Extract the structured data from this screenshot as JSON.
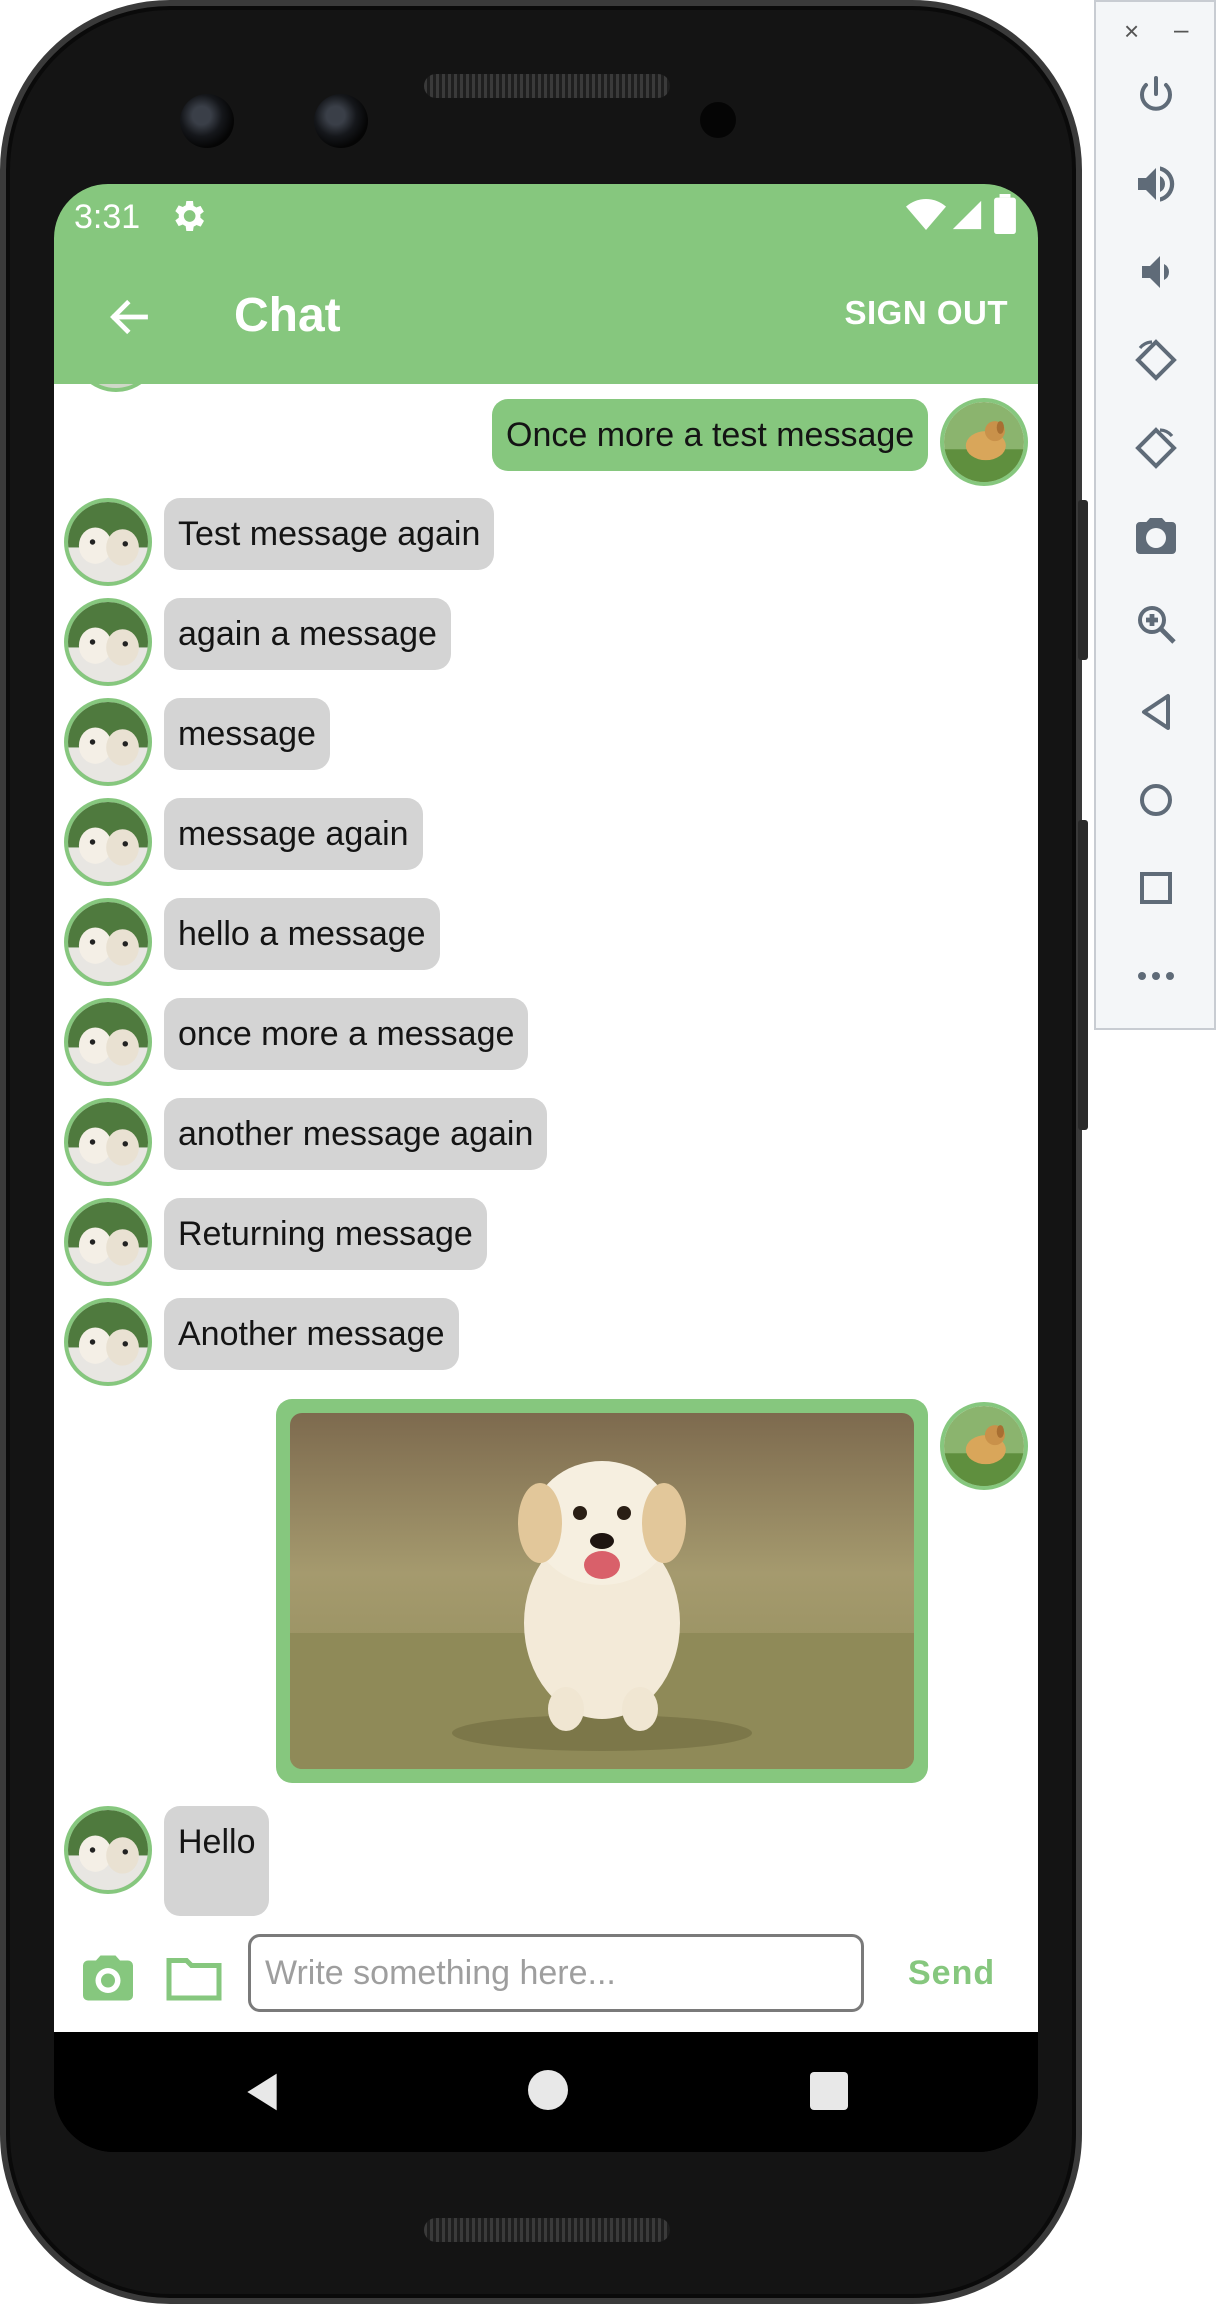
{
  "status_bar": {
    "time": "3:31"
  },
  "app_bar": {
    "title": "Chat",
    "sign_out_label": "SIGN OUT"
  },
  "messages": [
    {
      "direction": "outgoing",
      "text": "Once more a test message"
    },
    {
      "direction": "incoming",
      "text": "Test message again"
    },
    {
      "direction": "incoming",
      "text": "again a message"
    },
    {
      "direction": "incoming",
      "text": "message"
    },
    {
      "direction": "incoming",
      "text": "message again"
    },
    {
      "direction": "incoming",
      "text": "hello a message"
    },
    {
      "direction": "incoming",
      "text": "once more a message"
    },
    {
      "direction": "incoming",
      "text": "another message again"
    },
    {
      "direction": "incoming",
      "text": "Returning message"
    },
    {
      "direction": "incoming",
      "text": "Another message"
    },
    {
      "direction": "outgoing",
      "type": "image",
      "image": "golden-retriever-puppy-photo"
    },
    {
      "direction": "incoming",
      "text": "Hello"
    }
  ],
  "composer": {
    "placeholder": "Write something here...",
    "send_label": "Send"
  },
  "colors": {
    "accent": "#86c77e",
    "incoming_bubble": "#d4d4d4",
    "background": "#ffffff"
  },
  "emulator_panel": {
    "close": "×",
    "minimize": "–",
    "buttons": [
      "power-icon",
      "volume-up-icon",
      "volume-down-icon",
      "rotate-left-icon",
      "rotate-right-icon",
      "screenshot-camera-icon",
      "zoom-icon",
      "back-icon",
      "home-icon",
      "overview-icon",
      "more-icon"
    ]
  }
}
